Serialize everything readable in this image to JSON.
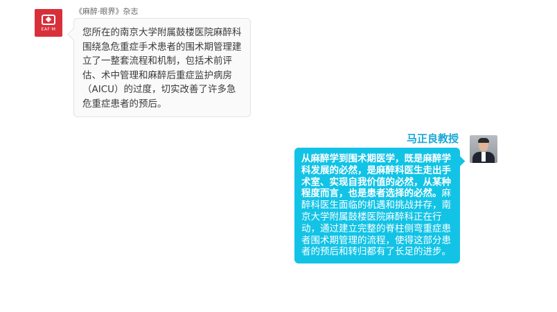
{
  "colors": {
    "brand_red": "#d8303a",
    "accent_blue": "#1aa7d6",
    "bubble_cyan": "#13c3e6",
    "bubble_gray": "#fafafa"
  },
  "left_message": {
    "sender": "《麻醉·眼界》杂志",
    "avatar_logo_text": "EAF·M",
    "text": "您所在的南京大学附属鼓楼医院麻醉科围绕急危重症手术患者的围术期管理建立了一整套流程和机制，包括术前评估、术中管理和麻醉后重症监护病房（AICU）的过度，切实改善了许多急危重症患者的预后。"
  },
  "right_message": {
    "sender": "马正良教授",
    "text_bold": "从麻醉学到围术期医学，既是麻醉学科发展的必然，是麻醉科医生走出手术室、实现自我价值的必然，从某种程度而言，也是患者选择的必然。",
    "text_normal": "麻醉科医生面临的机遇和挑战并存，南京大学附属鼓楼医院麻醉科正在行动，通过建立完整的脊柱侧弯重症患者围术期管理的流程，使得这部分患者的预后和转归都有了长足的进步。"
  }
}
